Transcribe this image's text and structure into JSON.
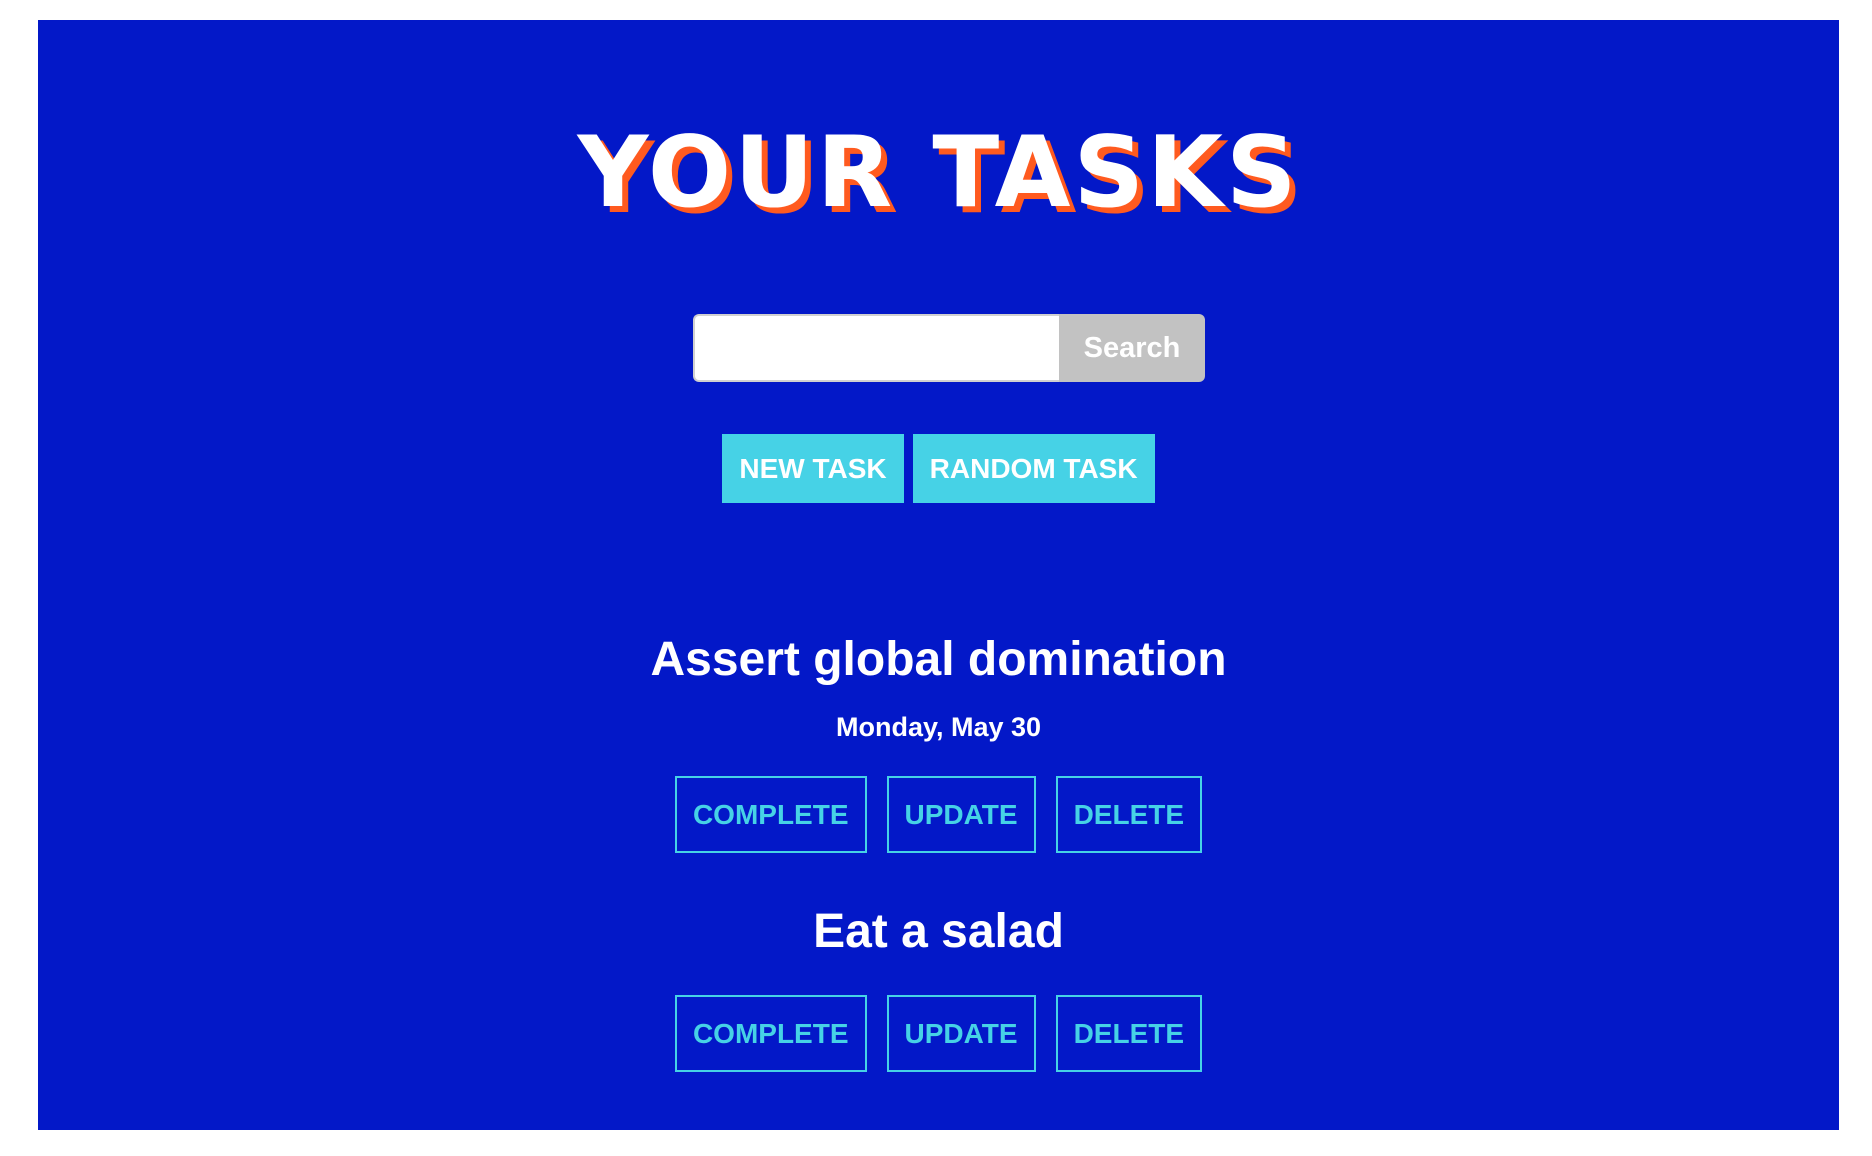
{
  "page": {
    "title": "YOUR TASKS",
    "colors": {
      "background": "#0318c8",
      "title_shadow": "#ff5a1f",
      "accent": "#46d2e6",
      "search_button": "#c2c2c2"
    }
  },
  "search": {
    "value": "",
    "placeholder": "",
    "button_label": "Search",
    "icon": "none"
  },
  "actions": {
    "new_task_label": "NEW TASK",
    "random_task_label": "RANDOM TASK"
  },
  "tasks": [
    {
      "title": "Assert global domination",
      "date": "Monday, May 30",
      "complete_label": "COMPLETE",
      "update_label": "UPDATE",
      "delete_label": "DELETE"
    },
    {
      "title": "Eat a salad",
      "date": "",
      "complete_label": "COMPLETE",
      "update_label": "UPDATE",
      "delete_label": "DELETE"
    }
  ]
}
